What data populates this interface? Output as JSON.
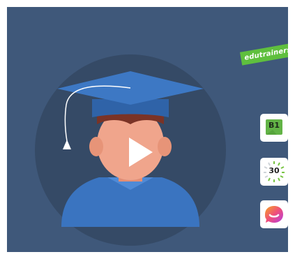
{
  "brand": {
    "name": "edutrainers"
  },
  "video": {
    "play_icon": "play-icon"
  },
  "badges": {
    "level": "B1",
    "timer": "30",
    "chat_icon": "chat-bubble-icon"
  },
  "colors": {
    "background": "#3f587a",
    "circle": "#354a66",
    "brand_green": "#5fbf3e",
    "cap_blue": "#3d78c4",
    "gown_blue": "#3a74c0",
    "skin": "#f0a58c",
    "hair": "#7a3326"
  }
}
